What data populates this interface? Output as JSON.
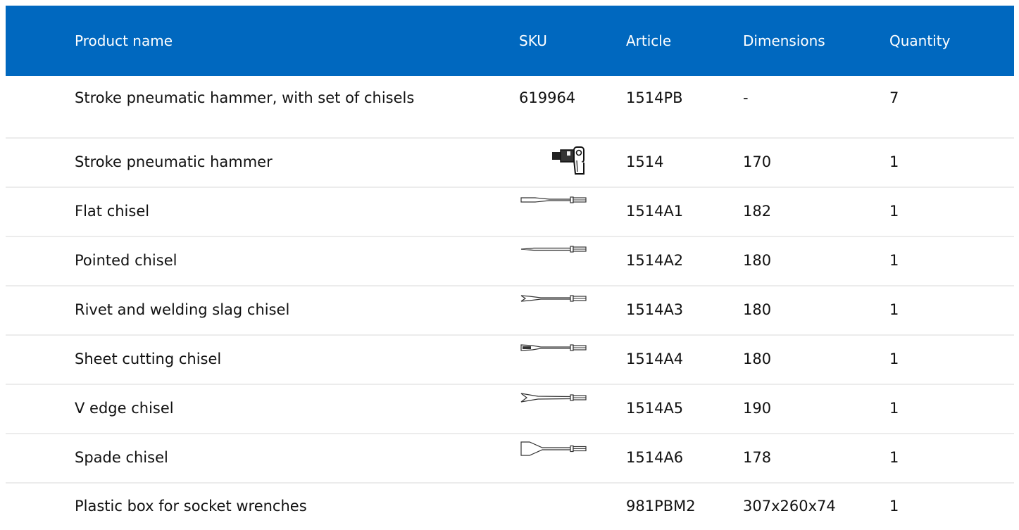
{
  "table": {
    "headers": {
      "product_name": "Product name",
      "sku": "SKU",
      "article": "Article",
      "dimensions": "Dimensions",
      "quantity": "Quantity"
    },
    "rows": [
      {
        "product_name": "Stroke pneumatic hammer, with set of chisels",
        "sku": "619964",
        "image_icon": "",
        "article": "1514PB",
        "dimensions": "-",
        "quantity": "7"
      },
      {
        "product_name": "Stroke pneumatic hammer",
        "sku": "",
        "image_icon": "pneumatic-hammer-icon",
        "article": "1514",
        "dimensions": "170",
        "quantity": "1"
      },
      {
        "product_name": "Flat chisel",
        "sku": "",
        "image_icon": "flat-chisel-icon",
        "article": "1514A1",
        "dimensions": "182",
        "quantity": "1"
      },
      {
        "product_name": "Pointed chisel",
        "sku": "",
        "image_icon": "pointed-chisel-icon",
        "article": "1514A2",
        "dimensions": "180",
        "quantity": "1"
      },
      {
        "product_name": "Rivet and welding slag chisel",
        "sku": "",
        "image_icon": "rivet-slag-chisel-icon",
        "article": "1514A3",
        "dimensions": "180",
        "quantity": "1"
      },
      {
        "product_name": "Sheet cutting chisel",
        "sku": "",
        "image_icon": "sheet-cutting-chisel-icon",
        "article": "1514A4",
        "dimensions": "180",
        "quantity": "1"
      },
      {
        "product_name": "V edge chisel",
        "sku": "",
        "image_icon": "v-edge-chisel-icon",
        "article": "1514A5",
        "dimensions": "190",
        "quantity": "1"
      },
      {
        "product_name": "Spade chisel",
        "sku": "",
        "image_icon": "spade-chisel-icon",
        "article": "1514A6",
        "dimensions": "178",
        "quantity": "1"
      },
      {
        "product_name": "Plastic box for socket wrenches",
        "sku": "",
        "image_icon": "",
        "article": "981PBM2",
        "dimensions": "307x260x74",
        "quantity": "1"
      }
    ]
  },
  "colors": {
    "header_bg": "#0068bf",
    "header_text": "#ffffff",
    "divider": "#ececec"
  }
}
